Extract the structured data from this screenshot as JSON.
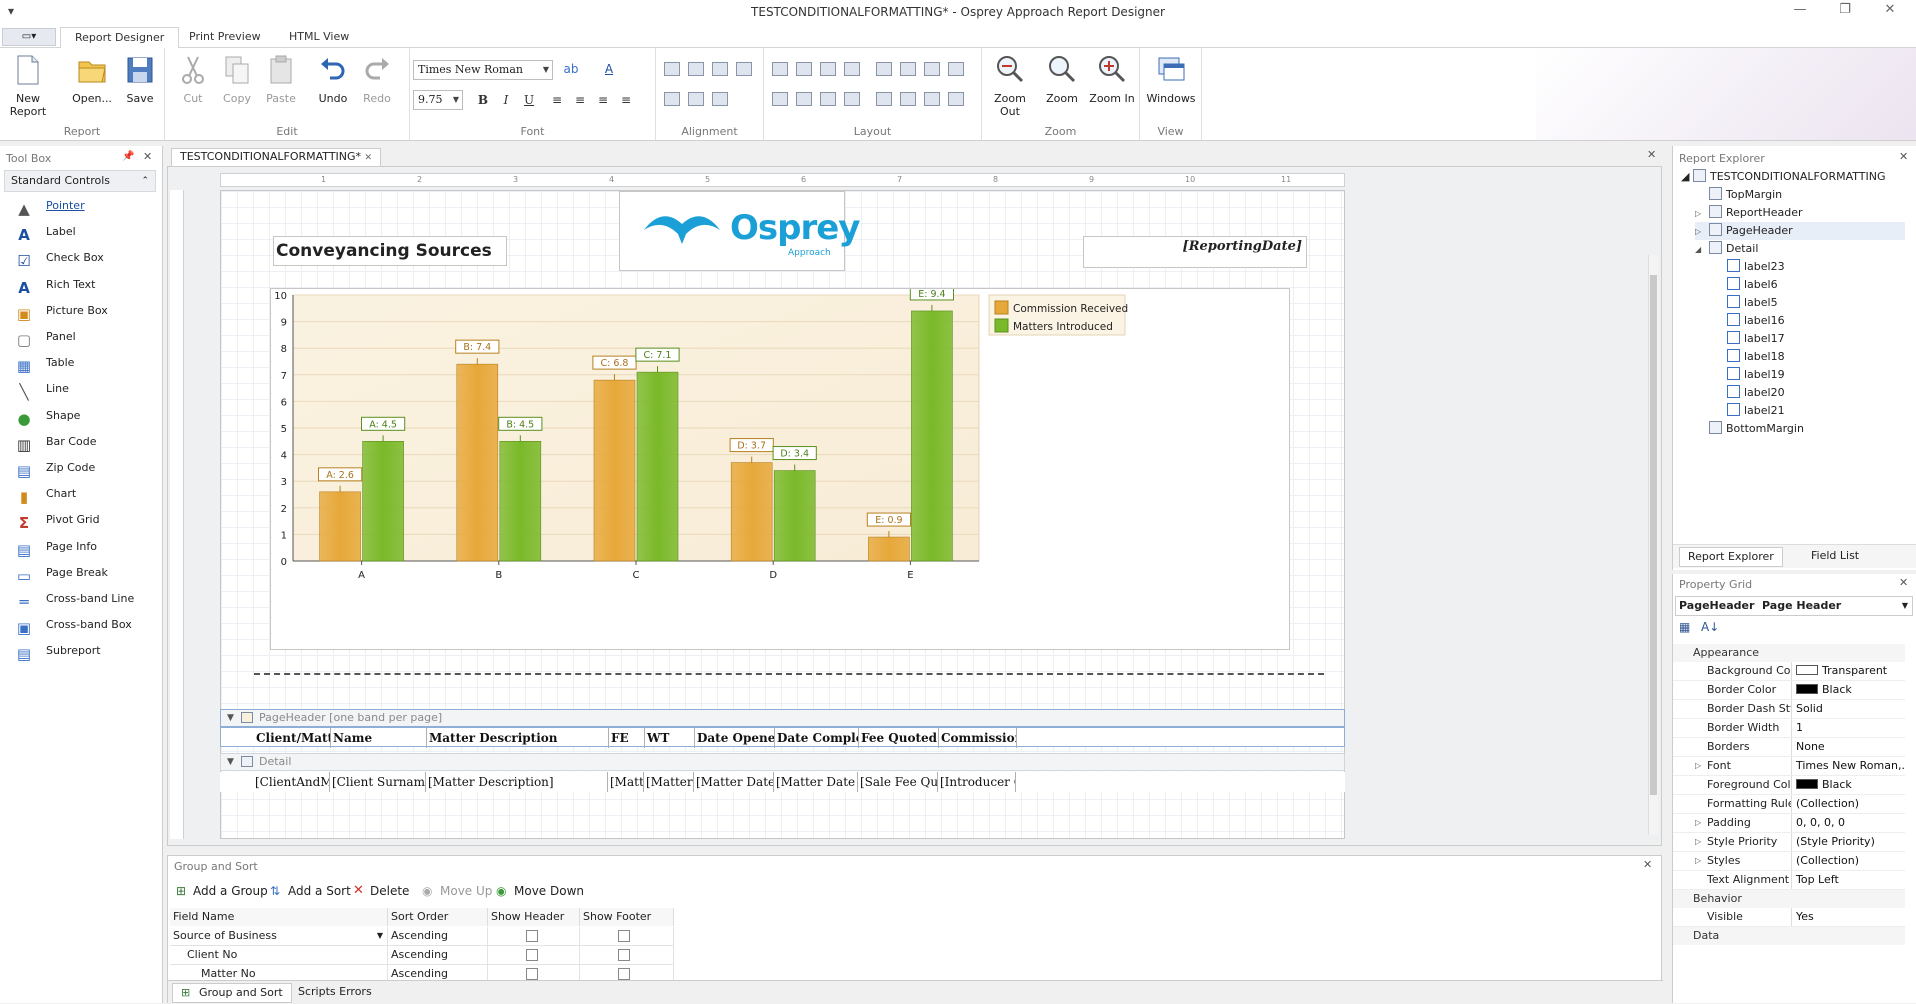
{
  "window": {
    "title": "TESTCONDITIONALFORMATTING* - Osprey Approach Report Designer"
  },
  "tabs": [
    "Report Designer",
    "Print Preview",
    "HTML View"
  ],
  "ribbon": {
    "report": {
      "label": "Report",
      "new_report": "New Report",
      "open": "Open...",
      "save": "Save"
    },
    "edit": {
      "label": "Edit",
      "cut": "Cut",
      "copy": "Copy",
      "paste": "Paste",
      "undo": "Undo",
      "redo": "Redo"
    },
    "font": {
      "label": "Font",
      "family": "Times New Roman",
      "size": "9.75",
      "bold": "B",
      "italic": "I",
      "underline": "U"
    },
    "alignment": {
      "label": "Alignment"
    },
    "layout": {
      "label": "Layout"
    },
    "zoom": {
      "label": "Zoom",
      "zoom_out": "Zoom Out",
      "zoom": "Zoom",
      "zoom_in": "Zoom In"
    },
    "view": {
      "label": "View",
      "windows": "Windows"
    }
  },
  "toolbox": {
    "title": "Tool Box",
    "category": "Standard Controls",
    "items": [
      "Pointer",
      "Label",
      "Check Box",
      "Rich Text",
      "Picture Box",
      "Panel",
      "Table",
      "Line",
      "Shape",
      "Bar Code",
      "Zip Code",
      "Chart",
      "Pivot Grid",
      "Page Info",
      "Page Break",
      "Cross-band Line",
      "Cross-band Box",
      "Subreport"
    ]
  },
  "document": {
    "tab": "TESTCONDITIONALFORMATTING*",
    "ruler_marks": [
      "1",
      "2",
      "3",
      "4",
      "5",
      "6",
      "7",
      "8",
      "9",
      "10",
      "11"
    ],
    "report_title": "Conveyancing Sources",
    "logo_text": "Osprey",
    "logo_sub": "Approach",
    "reporting_date": "[ReportingDate]",
    "page_header_band": "PageHeader [one band per page]",
    "detail_band": "Detail",
    "header_fields": [
      "Client/Matter",
      "Name",
      "Matter Description",
      "FE",
      "WT",
      "Date Opened",
      "Date Completed",
      "Fee Quoted",
      "Commission"
    ],
    "detail_fields": [
      "[ClientAndMatt",
      "[Client Surname]",
      "[Matter Description]",
      "[Matt",
      "[Matter W",
      "[Matter Date Op",
      "[Matter Date Com",
      "[Sale Fee Quote",
      "[Introducer Com"
    ]
  },
  "chart_data": {
    "type": "bar",
    "categories": [
      "A",
      "B",
      "C",
      "D",
      "E"
    ],
    "series": [
      {
        "name": "Commission Received",
        "values": [
          2.6,
          7.4,
          6.8,
          3.7,
          0.9
        ],
        "color": "#e7a83a",
        "labels": [
          "A: 2.6",
          "B: 7.4",
          "C: 6.8",
          "D: 3.7",
          "E: 0.9"
        ]
      },
      {
        "name": "Matters Introduced",
        "values": [
          4.5,
          4.5,
          7.1,
          3.4,
          9.4
        ],
        "color": "#7ab929",
        "labels": [
          "A: 4.5",
          "B: 4.5",
          "C: 7.1",
          "D: 3.4",
          "E: 9.4"
        ]
      }
    ],
    "y_ticks": [
      "0",
      "1",
      "2",
      "3",
      "4",
      "5",
      "6",
      "7",
      "8",
      "9",
      "10"
    ],
    "ylim": [
      0,
      10
    ],
    "legend": "top-right",
    "grid": true
  },
  "explorer": {
    "title": "Report Explorer",
    "root": "TESTCONDITIONALFORMATTING",
    "nodes": [
      "TopMargin",
      "ReportHeader",
      "PageHeader",
      "Detail"
    ],
    "detail_children": [
      "label23",
      "label6",
      "label5",
      "label16",
      "label17",
      "label18",
      "label19",
      "label20",
      "label21"
    ],
    "bottom": "BottomMargin",
    "tabs": [
      "Report Explorer",
      "Field List"
    ]
  },
  "property_grid": {
    "title": "Property Grid",
    "selected": "PageHeader  Page Header",
    "categories": [
      "Appearance",
      "Behavior",
      "Data"
    ],
    "appearance": [
      {
        "name": "Background Colo",
        "value": "Transparent",
        "swatch": "#ffffff"
      },
      {
        "name": "Border Color",
        "value": "Black",
        "swatch": "#000000"
      },
      {
        "name": "Border Dash Sty",
        "value": "Solid"
      },
      {
        "name": "Border Width",
        "value": "1"
      },
      {
        "name": "Borders",
        "value": "None"
      },
      {
        "name": "Font",
        "value": "Times New Roman,...",
        "expand": true
      },
      {
        "name": "Foreground Colo",
        "value": "Black",
        "swatch": "#000000"
      },
      {
        "name": "Formatting Rule",
        "value": "(Collection)"
      },
      {
        "name": "Padding",
        "value": "0, 0, 0, 0",
        "expand": true
      },
      {
        "name": "Style Priority",
        "value": "(Style Priority)",
        "expand": true
      },
      {
        "name": "Styles",
        "value": "(Collection)",
        "expand": true
      },
      {
        "name": "Text Alignment",
        "value": "Top Left"
      }
    ],
    "behavior": [
      {
        "name": "Visible",
        "value": "Yes"
      }
    ]
  },
  "group_sort": {
    "title": "Group and Sort",
    "actions": [
      "Add a Group",
      "Add a Sort",
      "Delete",
      "Move Up",
      "Move Down"
    ],
    "columns": [
      "Field Name",
      "Sort Order",
      "Show Header",
      "Show Footer"
    ],
    "rows": [
      {
        "field": "Source of Business",
        "order": "Ascending"
      },
      {
        "field": "Client No",
        "order": "Ascending"
      },
      {
        "field": "Matter No",
        "order": "Ascending"
      }
    ],
    "bottom_tabs": [
      "Group and Sort",
      "Scripts Errors"
    ]
  }
}
